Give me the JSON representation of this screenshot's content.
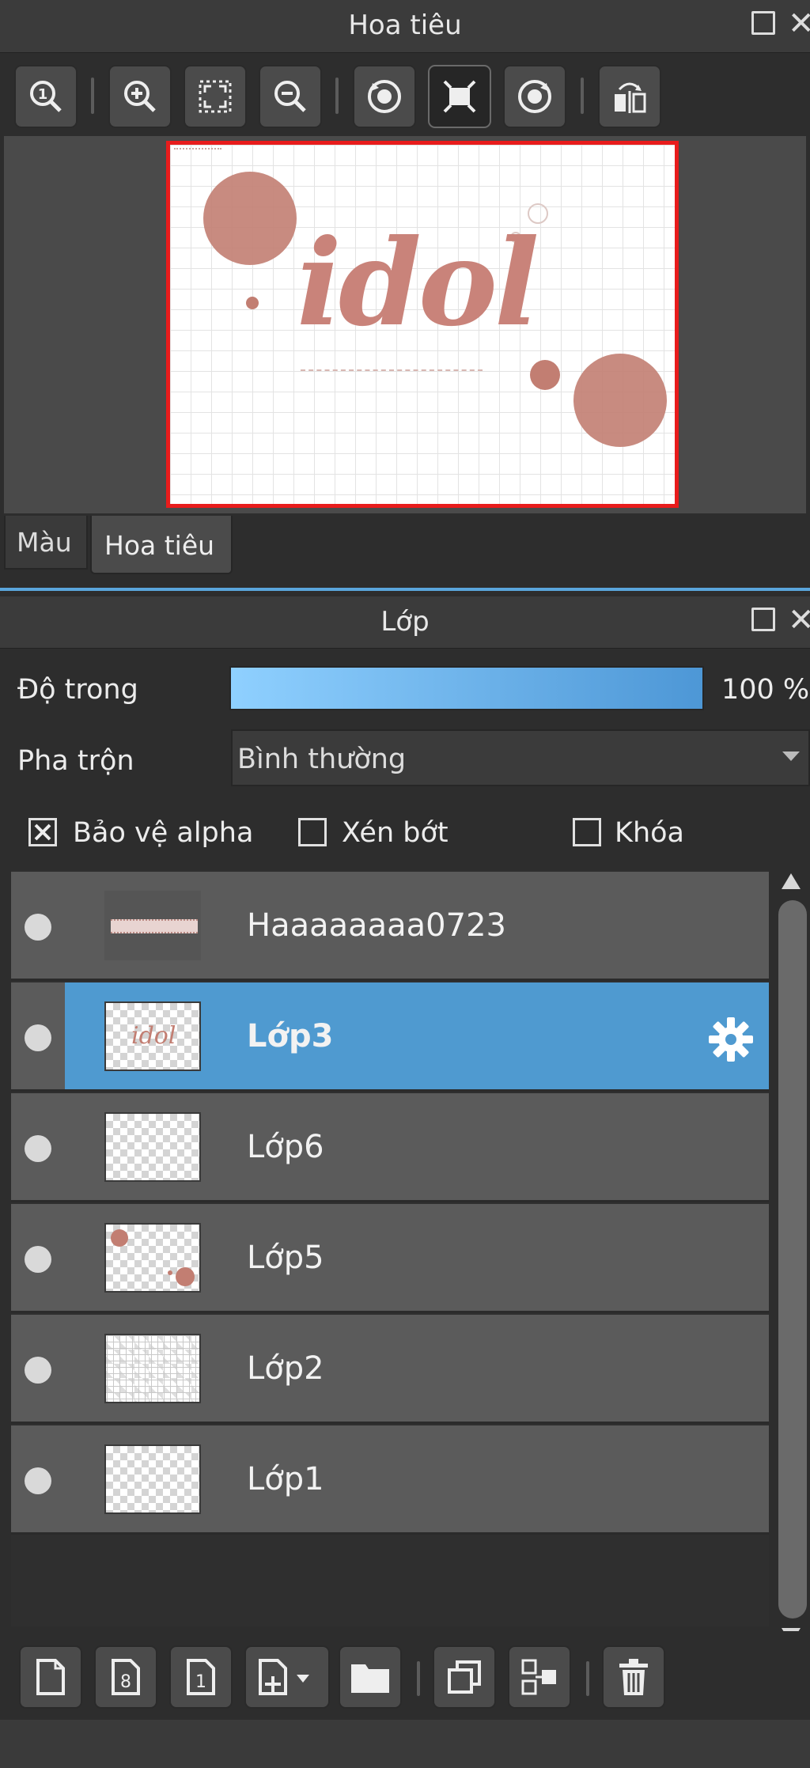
{
  "navigator": {
    "title": "Hoa tiêu",
    "toolbar_icons": [
      "zoom-actual-icon",
      "zoom-in-icon",
      "fit-screen-icon",
      "zoom-out-icon",
      "rotate-left-icon",
      "fit-canvas-icon",
      "rotate-right-icon",
      "flip-icon"
    ],
    "canvas_text": "idol"
  },
  "tabs": [
    {
      "label": "Màu",
      "active": false
    },
    {
      "label": "Hoa tiêu",
      "active": true
    }
  ],
  "layers_panel": {
    "title": "Lớp",
    "opacity_label": "Độ trong",
    "opacity_value": "100 %",
    "opacity_fraction": 1.0,
    "blend_label": "Pha trộn",
    "blend_value": "Bình thường",
    "protect_alpha_label": "Bảo vệ alpha",
    "protect_alpha_checked": true,
    "clipping_label": "Xén bớt",
    "clipping_checked": false,
    "lock_label": "Khóa",
    "lock_checked": false,
    "layers": [
      {
        "name": "Haaaaaaaa0723",
        "selected": false,
        "thumb": "text-strip"
      },
      {
        "name": "Lớp3",
        "selected": true,
        "thumb": "idol"
      },
      {
        "name": "Lớp6",
        "selected": false,
        "thumb": "empty"
      },
      {
        "name": "Lớp5",
        "selected": false,
        "thumb": "circles"
      },
      {
        "name": "Lớp2",
        "selected": false,
        "thumb": "grid"
      },
      {
        "name": "Lớp1",
        "selected": false,
        "thumb": "empty"
      }
    ],
    "bottom_icons": [
      "new-layer-icon",
      "new-8bit-layer-icon",
      "new-1bit-layer-icon",
      "add-layer-menu-icon",
      "folder-icon",
      "duplicate-icon",
      "merge-down-icon",
      "delete-icon"
    ]
  },
  "colors": {
    "accent": "#4f9ad0",
    "highlight": "#e81c1c",
    "dot": "#c27e72"
  }
}
